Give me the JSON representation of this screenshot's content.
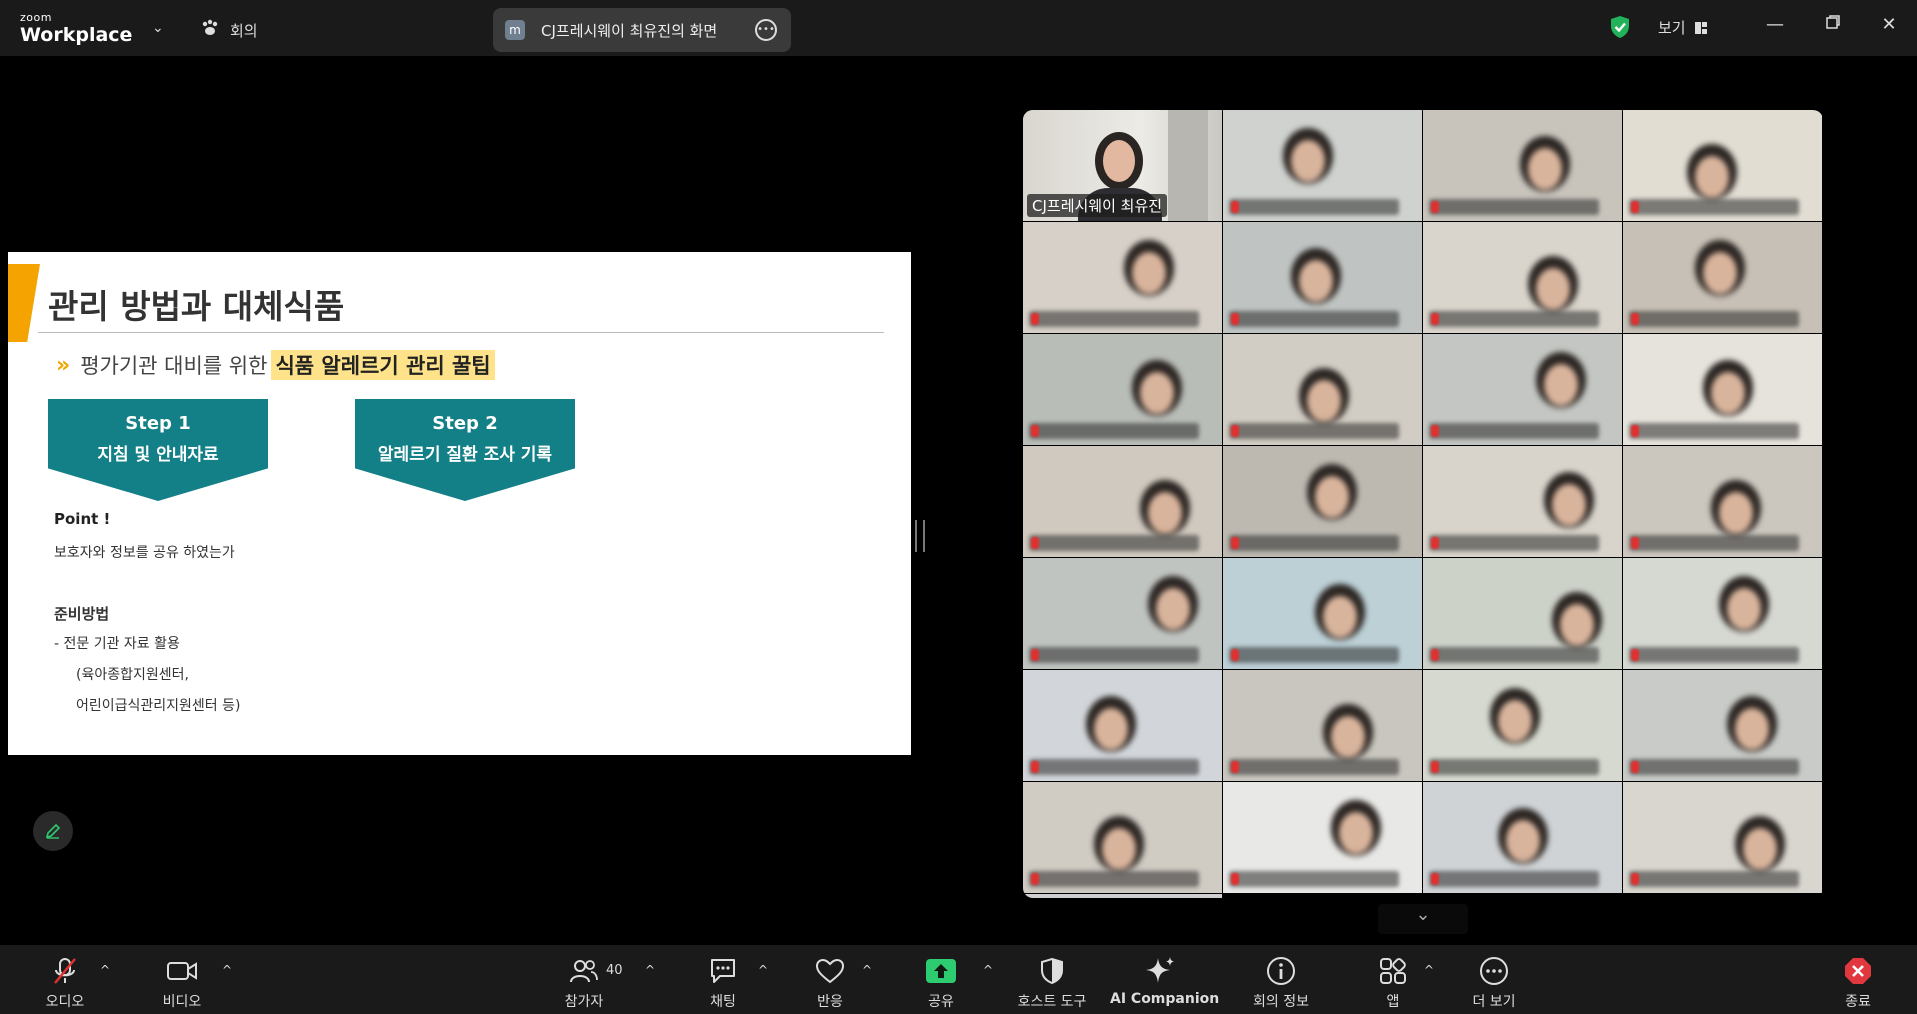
{
  "titlebar": {
    "brand_small": "zoom",
    "brand_large": "Workplace",
    "meeting_label": "회의",
    "share_badge": "m",
    "share_title": "CJ프레시웨이 최유진의 화면",
    "view_label": "보기"
  },
  "slide": {
    "title": "관리 방법과 대체식품",
    "subtitle_prefix": "평가기관 대비를 위한",
    "subtitle_highlight": "식품 알레르기 관리 꿀팁",
    "steps": [
      {
        "step": "Step 1",
        "label": "지침 및 안내자료"
      },
      {
        "step": "Step 2",
        "label": "알레르기 질환 조사 기록"
      }
    ],
    "point_title": "Point !",
    "point_text": "보호자와 정보를 공유 하였는가",
    "prep_title": "준비방법",
    "prep_lines": [
      "-   전문 기관 자료 활용",
      "(육아종합지원센터,",
      "어린이급식관리지원센터 등)"
    ]
  },
  "gallery": {
    "active_speaker": "CJ프레시웨이 최유진",
    "accent_color": "#2ecc71"
  },
  "toolbar": {
    "audio": "오디오",
    "video": "비디오",
    "participants": "참가자",
    "participant_count": "40",
    "chat": "채팅",
    "reactions": "반응",
    "share": "공유",
    "host_tools": "호스트 도구",
    "ai_companion": "AI Companion",
    "meeting_info": "회의 정보",
    "apps": "앱",
    "more": "더 보기",
    "end": "종료",
    "share_color": "#2ecc71",
    "end_color": "#e0383e"
  }
}
